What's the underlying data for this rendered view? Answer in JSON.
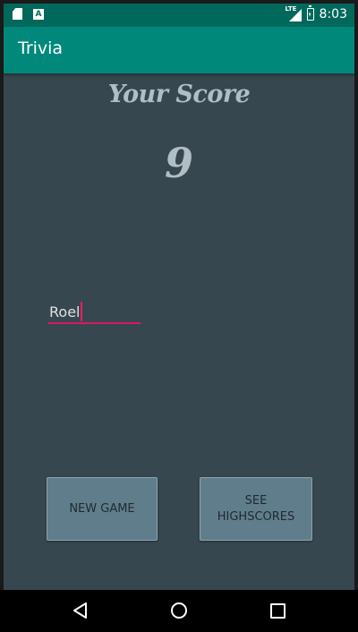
{
  "status_bar": {
    "time": "8:03",
    "network": "LTE",
    "left_icons": [
      "sd-card-icon",
      "a-notification-icon"
    ],
    "notification_letter": "A"
  },
  "app_bar": {
    "title": "Trivia",
    "color": "#00897b"
  },
  "score": {
    "label": "Your Score",
    "value": "9"
  },
  "name_input": {
    "value": "Roel",
    "underline_color": "#d81b60"
  },
  "buttons": {
    "new_game": "NEW GAME",
    "see_highscores": "SEE HIGHSCORES"
  },
  "nav_bar": {
    "icons": [
      "back-icon",
      "home-icon",
      "recents-icon"
    ]
  },
  "colors": {
    "background": "#37474f",
    "status_bar": "#00695c",
    "button": "#607d8b",
    "score_text": "#b0bec5"
  }
}
